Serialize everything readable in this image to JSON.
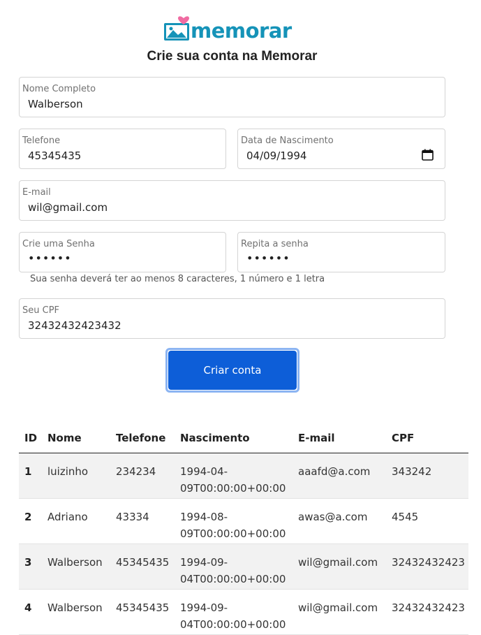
{
  "brand": {
    "name": "memorar",
    "primary": "#1593b8",
    "heart": "#f06ba2"
  },
  "heading": "Crie sua conta na Memorar",
  "form": {
    "nome": {
      "label": "Nome Completo",
      "value": "Walberson"
    },
    "telefone": {
      "label": "Telefone",
      "value": "45345435"
    },
    "nascimento": {
      "label": "Data de Nascimento",
      "value": "04/09/1994"
    },
    "email": {
      "label": "E-mail",
      "value": "wil@gmail.com"
    },
    "senha": {
      "label": "Crie uma Senha",
      "value": "••••••"
    },
    "repita": {
      "label": "Repita a senha",
      "value": "••••••"
    },
    "password_hint": "Sua senha deverá ter ao menos 8 caracteres, 1 número e 1 letra",
    "cpf": {
      "label": "Seu CPF",
      "value": "32432432423432"
    },
    "submit_label": "Criar conta"
  },
  "table": {
    "headers": [
      "ID",
      "Nome",
      "Telefone",
      "Nascimento",
      "E-mail",
      "CPF"
    ],
    "rows": [
      {
        "id": "1",
        "nome": "luizinho",
        "telefone": "234234",
        "nascimento_a": "1994-04-",
        "nascimento_b": "09T00:00:00+00:00",
        "email": "aaafd@a.com",
        "cpf": "343242"
      },
      {
        "id": "2",
        "nome": "Adriano",
        "telefone": "43334",
        "nascimento_a": "1994-08-",
        "nascimento_b": "09T00:00:00+00:00",
        "email": "awas@a.com",
        "cpf": "4545"
      },
      {
        "id": "3",
        "nome": "Walberson",
        "telefone": "45345435",
        "nascimento_a": "1994-09-",
        "nascimento_b": "04T00:00:00+00:00",
        "email": "wil@gmail.com",
        "cpf": "32432432423"
      },
      {
        "id": "4",
        "nome": "Walberson",
        "telefone": "45345435",
        "nascimento_a": "1994-09-",
        "nascimento_b": "04T00:00:00+00:00",
        "email": "wil@gmail.com",
        "cpf": "32432432423"
      }
    ]
  }
}
